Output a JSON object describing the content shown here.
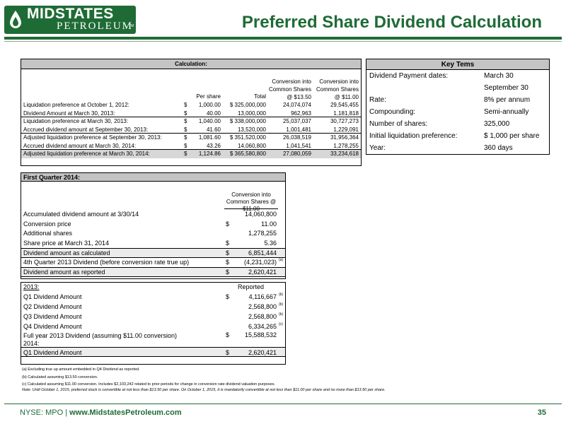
{
  "logo": {
    "line1": "MIDSTATES",
    "line2": "PETROLEUM",
    "tm": "TM"
  },
  "title": "Preferred Share Dividend Calculation",
  "calculation": {
    "header": "Calculation:",
    "col_headers": {
      "per_share": "Per share",
      "total": "Total",
      "conv1": "Conversion into Common Shares @ $13.50",
      "conv2": "Conversion into Common Shares @ $11.00"
    },
    "rows": [
      {
        "label": "Liquidation preference at October 1, 2012:",
        "ps_sym": "$",
        "ps": "1,000.00",
        "total": "$ 325,000,000",
        "c1": "24,074,074",
        "c2": "29,545,455"
      },
      {
        "label": "Dividend Amount at March 30, 2013:",
        "ps_sym": "$",
        "ps": "40.00",
        "total": "13,000,000",
        "c1": "962,963",
        "c2": "1,181,818"
      },
      {
        "label": "Liquidation preference at March 30, 2013:",
        "ps_sym": "$",
        "ps": "1,040.00",
        "total": "$ 338,000,000",
        "c1": "25,037,037",
        "c2": "30,727,273"
      },
      {
        "label": "Accrued dividend amount at September 30, 2013:",
        "ps_sym": "$",
        "ps": "41.60",
        "total": "13,520,000",
        "c1": "1,001,481",
        "c2": "1,229,091"
      },
      {
        "label": "Adjusted liquidation preference at September 30, 2013:",
        "ps_sym": "$",
        "ps": "1,081.60",
        "total": "$ 351,520,000",
        "c1": "26,038,519",
        "c2": "31,956,364"
      },
      {
        "label": "Accrued dividend amount at March 30, 2014:",
        "ps_sym": "$",
        "ps": "43.26",
        "total": "14,060,800",
        "c1": "1,041,541",
        "c2": "1,278,255"
      },
      {
        "label": "Adjusted liquidation preference at March 30, 2014:",
        "ps_sym": "$",
        "ps": "1,124.86",
        "total": "$ 365,580,800",
        "c1": "27,080,059",
        "c2": "33,234,618"
      }
    ]
  },
  "key_terms": {
    "header": "Key Tems",
    "rows": [
      {
        "k": "Dividend Payment dates:",
        "v": "March 30"
      },
      {
        "k": "",
        "v": "September 30"
      },
      {
        "k": "Rate:",
        "v": "8% per annum"
      },
      {
        "k": "Compounding:",
        "v": "Semi-annually"
      },
      {
        "k": "Number of shares:",
        "v": "325,000"
      },
      {
        "k": "Initial liquidation preference:",
        "v": "$ 1,000 per share"
      },
      {
        "k": "Year:",
        "v": "360 days"
      }
    ]
  },
  "q1_2014": {
    "header": "First Quarter 2014:",
    "col_header": "Conversion into Common Shares @ $11.00",
    "rows": [
      {
        "label": "Accumulated dividend amount at 3/30/14",
        "sym": "",
        "val": "14,060,800",
        "note": ""
      },
      {
        "label": "Conversion price",
        "sym": "$",
        "val": "11.00",
        "note": ""
      },
      {
        "label": "Additional shares",
        "sym": "",
        "val": "1,278,255",
        "note": ""
      },
      {
        "label": "Share price at March 31, 2014",
        "sym": "$",
        "val": "5.36",
        "note": ""
      },
      {
        "label": "Dividend amount as calculated",
        "sym": "$",
        "val": "6,851,444",
        "note": ""
      },
      {
        "label": "4th Quarter 2013 Dividend (before conversion rate true up)",
        "sym": "$",
        "val": "(4,231,023)",
        "note": "(a)"
      },
      {
        "label": "Dividend amount as reported",
        "sym": "$",
        "val": "2,620,421",
        "note": ""
      }
    ]
  },
  "y2013": {
    "header": "2013:",
    "col_header": "Reported",
    "rows": [
      {
        "label": "Q1 Dividend Amount",
        "sym": "$",
        "val": "4,116,667",
        "note": "(b)"
      },
      {
        "label": "Q2 Dividend Amount",
        "sym": "",
        "val": "2,568,800",
        "note": "(b)"
      },
      {
        "label": "Q3 Dividend Amount",
        "sym": "",
        "val": "2,568,800",
        "note": "(b)"
      },
      {
        "label": "Q4 Dividend Amount",
        "sym": "",
        "val": "6,334,265",
        "note": "(c)"
      },
      {
        "label": "Full year 2013 Dividend (assuming $11.00 conversion)",
        "label2": "2014:",
        "sym": "$",
        "val": "15,588,532",
        "note": ""
      },
      {
        "label": "Q1 Dividend Amount",
        "sym": "$",
        "val": "2,620,421",
        "note": ""
      }
    ]
  },
  "notes": {
    "a": "(a) Excluding true up amount embedded in Q4 Dividend as reported.",
    "b": "(b) Calculated assuming $13.50 conversion.",
    "c": "(c) Calculated assuming $11.00 conversion. Includes $2,103,242 related to prior periods for change in conversion rate dividend valuation purposes.",
    "note": "Note: Until October 1, 2015, preferred stock is convertible at not less than $13.50 per share. On October 1, 2015, it is mandatorily convertible at not less than $11.00 per share and no more than $13.50 per share."
  },
  "footer": {
    "ticker": "NYSE: MPO",
    "sep": "|",
    "url": "www.MidstatesPetroleum.com",
    "page": "35"
  },
  "colors": {
    "brand_green": "#1f6b36",
    "table_header_gray": "#c4c4c4"
  }
}
